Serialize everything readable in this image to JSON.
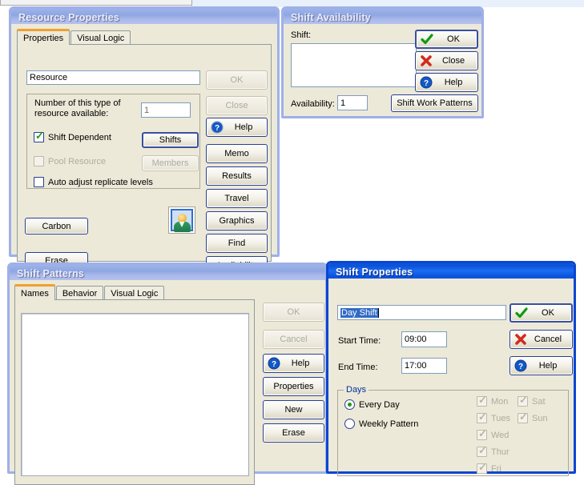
{
  "colors": {
    "active_title": "#0a51d8",
    "inactive_title": "#9db3e8",
    "dialog_face": "#ece9d8",
    "tab_accent": "#f0a030",
    "selection": "#316ac5",
    "group_title": "#00309c",
    "ok_check": "#14a014",
    "close_x": "#d22b1e"
  },
  "resource_properties": {
    "title": "Resource Properties",
    "active": false,
    "tabs": [
      {
        "label": "Properties",
        "active": true
      },
      {
        "label": "Visual Logic",
        "active": false
      }
    ],
    "name_field": {
      "value": "Resource",
      "placeholder": ""
    },
    "count_group": {
      "label_line1": "Number of this type of",
      "label_line2": "resource available:",
      "count_field": {
        "value": "1",
        "placeholder": ""
      },
      "shift_dependent": {
        "label": "Shift Dependent",
        "checked": true,
        "enabled": true
      },
      "shifts_button": {
        "label": "Shifts",
        "enabled": true
      },
      "pool_resource": {
        "label": "Pool Resource",
        "checked": false,
        "enabled": false
      },
      "members_button": {
        "label": "Members",
        "enabled": false
      },
      "auto_adjust": {
        "label": "Auto adjust replicate levels",
        "checked": false,
        "enabled": true
      }
    },
    "carbon_button": {
      "label": "Carbon",
      "enabled": true
    },
    "erase_button": {
      "label": "Erase",
      "enabled": true
    },
    "preview_icon": "person-avatar-icon",
    "side_buttons": [
      {
        "label": "OK",
        "enabled": false,
        "icon": ""
      },
      {
        "label": "Close",
        "enabled": false,
        "icon": ""
      },
      {
        "label": "Help",
        "enabled": true,
        "icon": "help-question-icon"
      },
      {
        "label": "Memo",
        "enabled": true,
        "icon": ""
      },
      {
        "label": "Results",
        "enabled": true,
        "icon": ""
      },
      {
        "label": "Travel",
        "enabled": true,
        "icon": ""
      },
      {
        "label": "Graphics",
        "enabled": true,
        "icon": ""
      },
      {
        "label": "Find",
        "enabled": true,
        "icon": ""
      },
      {
        "label": "Availability",
        "enabled": true,
        "icon": ""
      }
    ]
  },
  "shift_availability": {
    "title": "Shift Availability",
    "active": false,
    "shift_label": "Shift:",
    "shift_list_items": [],
    "availability_label": "Availability:",
    "availability_field": {
      "value": "1",
      "placeholder": ""
    },
    "shift_work_patterns_button": {
      "label": "Shift Work Patterns",
      "enabled": true
    },
    "side_buttons": [
      {
        "label": "OK",
        "enabled": true,
        "icon": "green-check-icon"
      },
      {
        "label": "Close",
        "enabled": true,
        "icon": "red-x-icon"
      },
      {
        "label": "Help",
        "enabled": true,
        "icon": "help-question-icon"
      }
    ]
  },
  "shift_patterns": {
    "title": "Shift Patterns",
    "active": false,
    "tabs": [
      {
        "label": "Names",
        "active": true
      },
      {
        "label": "Behavior",
        "active": false
      },
      {
        "label": "Visual Logic",
        "active": false
      }
    ],
    "list_items": [],
    "side_buttons": [
      {
        "label": "OK",
        "enabled": false,
        "icon": ""
      },
      {
        "label": "Cancel",
        "enabled": false,
        "icon": ""
      },
      {
        "label": "Help",
        "enabled": true,
        "icon": "help-question-icon"
      },
      {
        "label": "Properties",
        "enabled": true,
        "icon": ""
      },
      {
        "label": "New",
        "enabled": true,
        "icon": ""
      },
      {
        "label": "Erase",
        "enabled": true,
        "icon": ""
      }
    ]
  },
  "shift_properties": {
    "title": "Shift Properties",
    "active": true,
    "name_field": {
      "value": "Day Shift",
      "selected": true,
      "placeholder": ""
    },
    "start_time_label": "Start Time:",
    "start_time_field": {
      "value": "09:00",
      "placeholder": ""
    },
    "end_time_label": "End Time:",
    "end_time_field": {
      "value": "17:00",
      "placeholder": ""
    },
    "days_group": {
      "title": "Days",
      "every_day": {
        "label": "Every Day",
        "selected": true
      },
      "weekly_pattern": {
        "label": "Weekly Pattern",
        "selected": false
      },
      "day_checkboxes_col1": [
        {
          "label": "Mon",
          "checked": true,
          "enabled": false
        },
        {
          "label": "Tues",
          "checked": true,
          "enabled": false
        },
        {
          "label": "Wed",
          "checked": true,
          "enabled": false
        },
        {
          "label": "Thur",
          "checked": true,
          "enabled": false
        },
        {
          "label": "Fri",
          "checked": true,
          "enabled": false
        }
      ],
      "day_checkboxes_col2": [
        {
          "label": "Sat",
          "checked": true,
          "enabled": false
        },
        {
          "label": "Sun",
          "checked": true,
          "enabled": false
        }
      ]
    },
    "side_buttons": [
      {
        "label": "OK",
        "enabled": true,
        "icon": "green-check-icon"
      },
      {
        "label": "Cancel",
        "enabled": true,
        "icon": "red-x-icon"
      },
      {
        "label": "Help",
        "enabled": true,
        "icon": "help-question-icon"
      }
    ]
  }
}
